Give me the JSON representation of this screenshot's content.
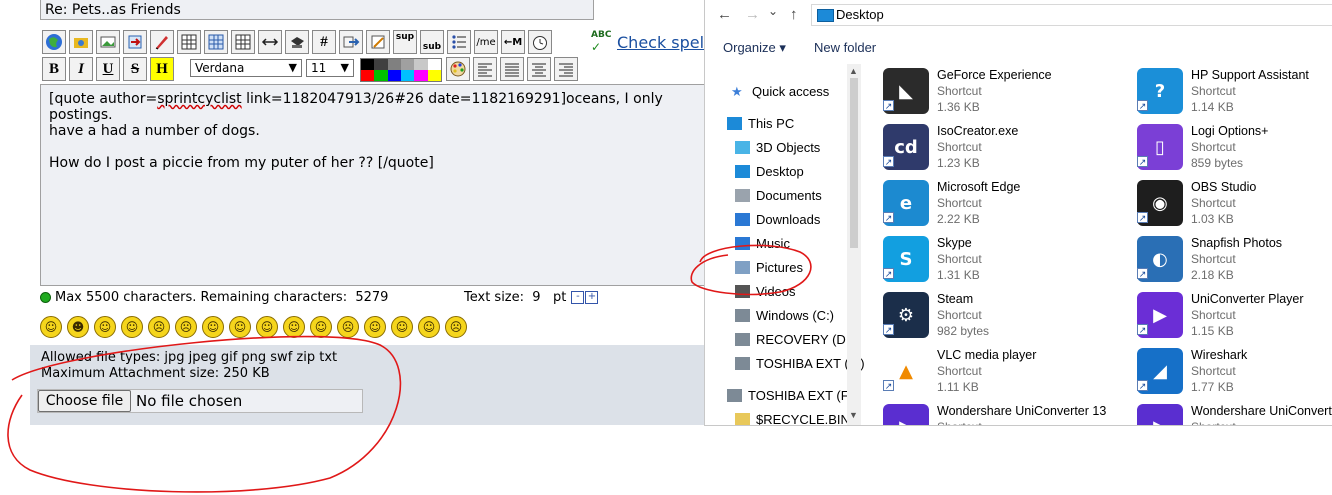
{
  "forum": {
    "subject_value": "Re: Pets..as Friends",
    "toolbar_row1_tooltips": [
      "globe",
      "flash",
      "image",
      "move",
      "strike",
      "table",
      "table2",
      "table3",
      "hr",
      "ftp",
      "hash",
      "quote",
      "edit",
      "sup",
      "sub",
      "list",
      "me",
      "arrow",
      "timer"
    ],
    "sup_label": "sup",
    "sub_label": "sub",
    "hash_label": "#",
    "me_label": "/me",
    "arrow_label": "←M",
    "abc_label": "ABC",
    "check_spelling": "Check spell",
    "format_buttons": [
      "B",
      "I",
      "U",
      "S",
      "H"
    ],
    "font_face": "Verdana",
    "font_size": "11",
    "colors": [
      "#000000",
      "#404040",
      "#808080",
      "#a0a0a0",
      "#c8c8c8",
      "#ffffff",
      "#ff0000",
      "#00c000",
      "#0000ff",
      "#00c0ff",
      "#ff00ff",
      "#ffff00"
    ],
    "editor_line1_pre": "[quote author=",
    "editor_line1_user": "sprintcyclist",
    "editor_line1_post": " link=1182047913/26#26 date=1182169291]oceans, I only",
    "editor_line2": "postings.",
    "editor_line3": "have a had a number of dogs.",
    "editor_line4": "",
    "editor_line5": "How do I post a piccie from my puter of her ?? [/quote]",
    "max_chars": "Max 5500 characters. Remaining characters:",
    "remaining": "5279",
    "text_size_label": "Text size:",
    "text_size_value": "9",
    "text_size_unit": "pt",
    "minus": "-",
    "plus": "+",
    "smileys": [
      "☺",
      "☻",
      "☺",
      "☺",
      "☹",
      "☹",
      "☺",
      "☺",
      "☺",
      "☺",
      "☺",
      "☹",
      "☺",
      "☺",
      "☺",
      "☹"
    ],
    "allowed_types": "Allowed file types: jpg jpeg gif png swf zip txt",
    "max_attachment": "Maximum Attachment size: 250 KB",
    "choose_file": "Choose file",
    "no_file": "No file chosen"
  },
  "explorer": {
    "back": "←",
    "forward": "→",
    "chevron": "⌄",
    "up": "↑",
    "address": "Desktop",
    "organize": "Organize",
    "organize_caret": "▾",
    "new_folder": "New folder",
    "nav": [
      {
        "label": "Quick access",
        "color": "#3d7fd8"
      },
      {
        "label": "This PC",
        "color": "#1c8ad8"
      },
      {
        "label": "3D Objects",
        "color": "#49b4e6"
      },
      {
        "label": "Desktop",
        "color": "#1c8ad8"
      },
      {
        "label": "Documents",
        "color": "#9aa3ad"
      },
      {
        "label": "Downloads",
        "color": "#2a78d4"
      },
      {
        "label": "Music",
        "color": "#2a78d4"
      },
      {
        "label": "Pictures",
        "color": "#7fa0c4"
      },
      {
        "label": "Videos",
        "color": "#555555"
      },
      {
        "label": "Windows (C:)",
        "color": "#7d8a96"
      },
      {
        "label": "RECOVERY (D:)",
        "color": "#7d8a96"
      },
      {
        "label": "TOSHIBA EXT (F:)",
        "color": "#7d8a96"
      },
      {
        "label": "TOSHIBA EXT (F:)",
        "color": "#7d8a96"
      },
      {
        "label": "$RECYCLE.BIN",
        "color": "#e8c85a"
      }
    ],
    "files": [
      {
        "name": "GeForce Experience",
        "type": "Shortcut",
        "size": "1.36 KB",
        "icon": "nvidia-icon",
        "bg": "#2b2b2b",
        "glyph": "◣"
      },
      {
        "name": "HP Support Assistant",
        "type": "Shortcut",
        "size": "1.14 KB",
        "icon": "help-icon",
        "bg": "#1b8fd8",
        "glyph": "?"
      },
      {
        "name": "IsoCreator.exe",
        "type": "Shortcut",
        "size": "1.23 KB",
        "icon": "disc-icon",
        "bg": "#2f3a6b",
        "glyph": "cd"
      },
      {
        "name": "Logi Options+",
        "type": "Shortcut",
        "size": "859 bytes",
        "icon": "mouse-icon",
        "bg": "#7b3fd6",
        "glyph": "▯"
      },
      {
        "name": "Microsoft Edge",
        "type": "Shortcut",
        "size": "2.22 KB",
        "icon": "edge-icon",
        "bg": "#1c8ad0",
        "glyph": "e"
      },
      {
        "name": "OBS Studio",
        "type": "Shortcut",
        "size": "1.03 KB",
        "icon": "obs-icon",
        "bg": "#1e1e1e",
        "glyph": "◉"
      },
      {
        "name": "Skype",
        "type": "Shortcut",
        "size": "1.31 KB",
        "icon": "skype-icon",
        "bg": "#129fe0",
        "glyph": "S"
      },
      {
        "name": "Snapfish Photos",
        "type": "Shortcut",
        "size": "2.18 KB",
        "icon": "snapfish-icon",
        "bg": "#2a6fb5",
        "glyph": "◐"
      },
      {
        "name": "Steam",
        "type": "Shortcut",
        "size": "982 bytes",
        "icon": "steam-icon",
        "bg": "#1b2e4a",
        "glyph": "⚙"
      },
      {
        "name": "UniConverter Player",
        "type": "Shortcut",
        "size": "1.15 KB",
        "icon": "player-icon",
        "bg": "#6b2ed6",
        "glyph": "▶"
      },
      {
        "name": "VLC media player",
        "type": "Shortcut",
        "size": "1.11 KB",
        "icon": "vlc-icon",
        "bg": "#ffffff",
        "glyph": "▲"
      },
      {
        "name": "Wireshark",
        "type": "Shortcut",
        "size": "1.77 KB",
        "icon": "wireshark-icon",
        "bg": "#1670c8",
        "glyph": "◢"
      },
      {
        "name": "Wondershare UniConverter 13",
        "type": "Shortcut",
        "size": "",
        "icon": "uniconverter-icon",
        "bg": "#5a2ed0",
        "glyph": "▶"
      },
      {
        "name": "Wondershare UniConverter",
        "type": "Shortcut",
        "size": "",
        "icon": "uniconverter-icon",
        "bg": "#5a2ed0",
        "glyph": "▶"
      }
    ]
  },
  "annotation_color": "#e01818"
}
